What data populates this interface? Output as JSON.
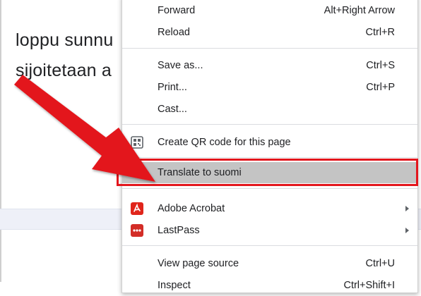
{
  "page": {
    "line1": "loppu sunnu",
    "line2": "sijoitetaan a"
  },
  "menu": {
    "items": [
      {
        "label": "Forward",
        "shortcut": "Alt+Right Arrow"
      },
      {
        "label": "Reload",
        "shortcut": "Ctrl+R"
      },
      {
        "label": "Save as...",
        "shortcut": "Ctrl+S"
      },
      {
        "label": "Print...",
        "shortcut": "Ctrl+P"
      },
      {
        "label": "Cast...",
        "shortcut": ""
      },
      {
        "label": "Create QR code for this page",
        "shortcut": "",
        "icon": "qr-code-icon"
      },
      {
        "label": "Translate to suomi",
        "shortcut": "",
        "highlighted": true
      },
      {
        "label": "Adobe Acrobat",
        "shortcut": "",
        "icon": "adobe-acrobat-icon",
        "submenu": true
      },
      {
        "label": "LastPass",
        "shortcut": "",
        "icon": "lastpass-icon",
        "submenu": true
      },
      {
        "label": "View page source",
        "shortcut": "Ctrl+U"
      },
      {
        "label": "Inspect",
        "shortcut": "Ctrl+Shift+I"
      }
    ]
  },
  "annotation": {
    "arrow_color": "#e3161d",
    "box_color": "#e3161d"
  }
}
